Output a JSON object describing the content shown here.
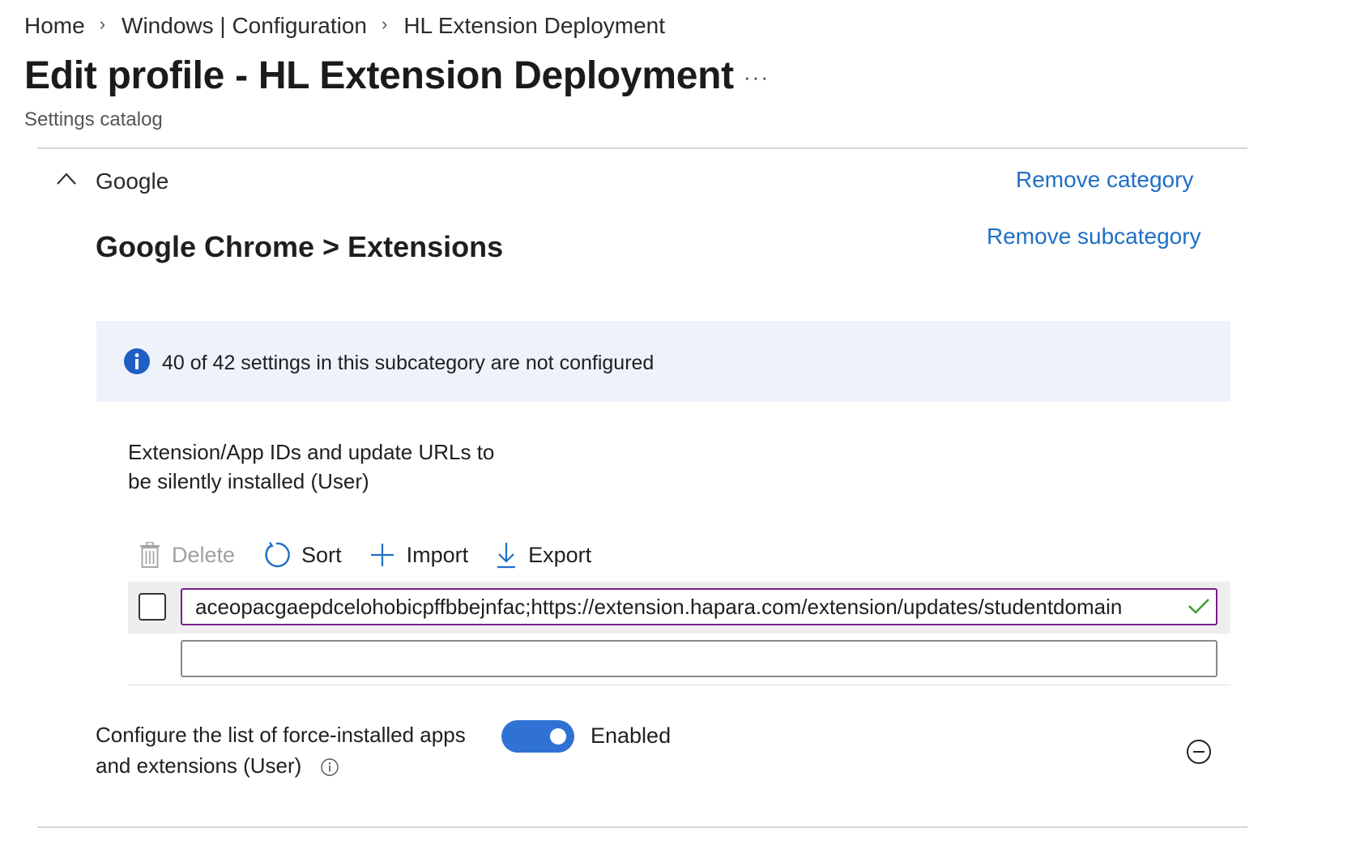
{
  "breadcrumb": {
    "items": [
      "Home",
      "Windows | Configuration",
      "HL Extension Deployment"
    ],
    "separator": "›"
  },
  "header": {
    "title": "Edit profile - HL Extension Deployment",
    "more_label": "···",
    "subtitle": "Settings catalog"
  },
  "category": {
    "name": "Google",
    "remove_label": "Remove category"
  },
  "subcategory": {
    "title": "Google Chrome > Extensions",
    "remove_label": "Remove subcategory"
  },
  "info_banner": {
    "text": "40 of 42 settings in this subcategory are not configured"
  },
  "setting_list": {
    "label_line1": "Extension/App IDs and update URLs to",
    "label_line2": "be silently installed (User)",
    "toolbar": {
      "delete_label": "Delete",
      "sort_label": "Sort",
      "import_label": "Import",
      "export_label": "Export"
    },
    "rows": [
      {
        "value": "aceopacgaepdcelohobicpffbbejnfac;https://extension.hapara.com/extension/updates/studentdomain",
        "valid": true
      },
      {
        "value": ""
      }
    ]
  },
  "setting_toggle": {
    "label_line1": "Configure the list of force-installed apps",
    "label_line2": "and extensions (User)",
    "state_label": "Enabled",
    "enabled": true
  },
  "colors": {
    "link": "#1f6fc5",
    "toggle_on": "#2f72d4",
    "info_bg": "#eef3fb",
    "input_focus_border": "#7a1d8f",
    "valid_check": "#3f9b2f"
  }
}
